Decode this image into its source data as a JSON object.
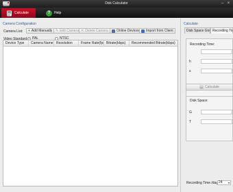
{
  "window": {
    "title": "Disk Calculator"
  },
  "toolbar": {
    "tabs": [
      {
        "label": "Calculate",
        "active": true
      },
      {
        "label": "Help",
        "active": false
      }
    ],
    "accent": "#c8102a"
  },
  "config": {
    "section_title": "Camera Configuration",
    "camera_list_label": "Camera List:",
    "buttons": {
      "add": "Add Manually",
      "edit": "Edit Camera",
      "delete": "Delete Camera",
      "online": "Online Devices",
      "import": "Import from Client"
    },
    "video_standard_label": "Video Standard",
    "standards": [
      {
        "label": "PAL",
        "checked": true
      },
      {
        "label": "NTSC",
        "checked": false
      }
    ],
    "table": {
      "columns": [
        "Device Type",
        "Camera Name",
        "Resolution",
        "Frame Rate(fps)",
        "Bitrate(kbps)",
        "Recommended Bitrate(kbps)"
      ]
    }
  },
  "calculate": {
    "section_title": "Calculate",
    "tabs": [
      {
        "label": "Disk Space Given",
        "active": false
      },
      {
        "label": "Recording Time",
        "active": true
      }
    ],
    "recording_time_label": "Recording Time:",
    "units": [
      "h",
      "s"
    ],
    "calculate_button": "Calculate",
    "disk_space_label": "Disk Space:",
    "disk_units": [
      "G",
      "T"
    ],
    "bottom_label": "Recording Time /day",
    "bottom_value": "24"
  }
}
